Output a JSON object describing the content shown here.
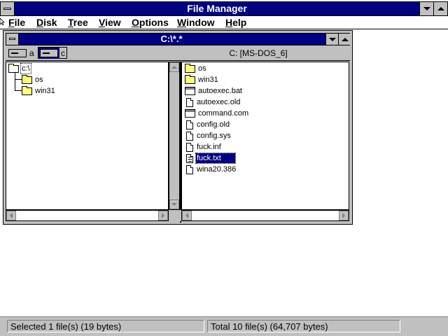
{
  "window": {
    "title": "File Manager"
  },
  "menu": {
    "items": [
      {
        "label": "File",
        "u": "F",
        "rest": "ile"
      },
      {
        "label": "Disk",
        "u": "D",
        "rest": "isk"
      },
      {
        "label": "Tree",
        "u": "T",
        "rest": "ree"
      },
      {
        "label": "View",
        "u": "V",
        "rest": "iew"
      },
      {
        "label": "Options",
        "u": "O",
        "rest": "ptions"
      },
      {
        "label": "Window",
        "u": "W",
        "rest": "indow"
      },
      {
        "label": "Help",
        "u": "H",
        "rest": "elp"
      }
    ]
  },
  "child": {
    "title": "C:\\*.*",
    "drives": [
      {
        "letter": "a",
        "icon": "floppy-drive-icon",
        "selected": false
      },
      {
        "letter": "c",
        "icon": "hard-drive-icon",
        "selected": true
      }
    ],
    "volume_label": "C: [MS-DOS_6]",
    "tree": [
      {
        "label": "c:\\",
        "icon": "open-folder-icon",
        "level": 0
      },
      {
        "label": "os",
        "icon": "folder-icon",
        "level": 1
      },
      {
        "label": "win31",
        "icon": "folder-icon",
        "level": 1
      }
    ],
    "files": [
      {
        "name": "os",
        "icon": "folder-icon",
        "selected": false
      },
      {
        "name": "win31",
        "icon": "folder-icon",
        "selected": false
      },
      {
        "name": "autoexec.bat",
        "icon": "program-icon",
        "selected": false
      },
      {
        "name": "autoexec.old",
        "icon": "document-icon",
        "selected": false
      },
      {
        "name": "command.com",
        "icon": "program-icon",
        "selected": false
      },
      {
        "name": "config.old",
        "icon": "document-icon",
        "selected": false
      },
      {
        "name": "config.sys",
        "icon": "document-icon",
        "selected": false
      },
      {
        "name": "fuck.inf",
        "icon": "document-icon",
        "selected": false
      },
      {
        "name": "fuck.txt",
        "icon": "text-document-icon",
        "selected": true
      },
      {
        "name": "wina20.386",
        "icon": "document-icon",
        "selected": false
      }
    ]
  },
  "status": {
    "selected": "Selected 1 file(s) (19 bytes)",
    "total": "Total 10 file(s) (64,707 bytes)"
  },
  "colors": {
    "titlebar": "#000080",
    "face": "#c0c0c0",
    "folder": "#ffff80",
    "selection": "#000080"
  }
}
